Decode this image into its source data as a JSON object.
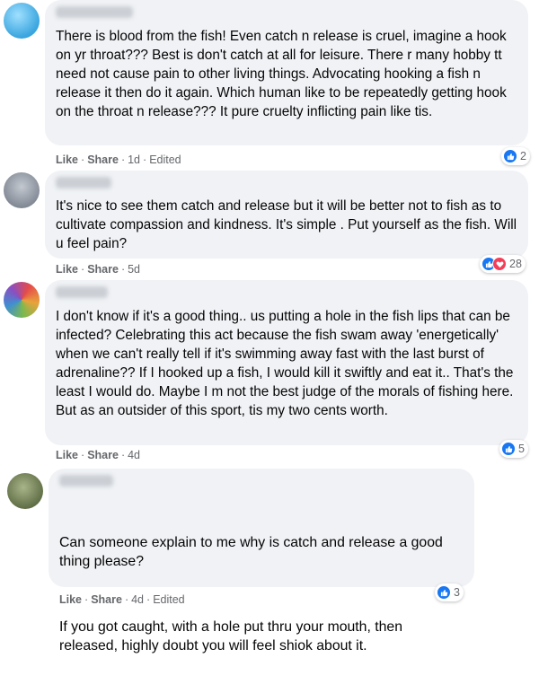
{
  "comments": [
    {
      "text": "There is blood from the fish! Even catch n release is cruel, imagine a hook on yr throat??? Best is don't catch at all for leisure. There r many hobby tt need not cause pain to other living things. Advocating hooking a fish n release it then do it again. Which human like to be repeatedly getting hook on the throat n release??? It pure cruelty inflicting pain like tis.",
      "like": "Like",
      "share": "Share",
      "time": "1d",
      "edited": "Edited",
      "reaction_count": "2",
      "avatar_color": "#4fb6e8"
    },
    {
      "text": "It's nice to see them catch and release but it will be better not to fish as to cultivate compassion and kindness. It's simple . Put yourself as the fish. Will u feel pain?",
      "like": "Like",
      "share": "Share",
      "time": "5d",
      "reaction_count": "28",
      "avatar_color": "#8f97a3"
    },
    {
      "text": "I don't know if it's a good thing.. us putting a hole in the fish lips that can be infected? Celebrating this act because the fish swam away 'energetically' when we can't really tell if it's swimming away fast with the last burst of adrenaline?? If I hooked up a fish, I would kill it swiftly and eat it.. That's the least I would do. Maybe I m not the best judge of the morals of fishing here. But as an outsider of this sport, tis my two cents worth.",
      "like": "Like",
      "share": "Share",
      "time": "4d",
      "reaction_count": "5",
      "avatar_color": "#7a8a3e"
    },
    {
      "text": "Can someone explain to me why is catch and release a good thing please?",
      "text2": "If you got caught, with a hole put thru your mouth, then released, highly doubt you will feel shiok about it.",
      "like": "Like",
      "share": "Share",
      "time": "4d",
      "edited": "Edited",
      "reaction_count": "3",
      "avatar_color": "#6b7a4a"
    }
  ]
}
